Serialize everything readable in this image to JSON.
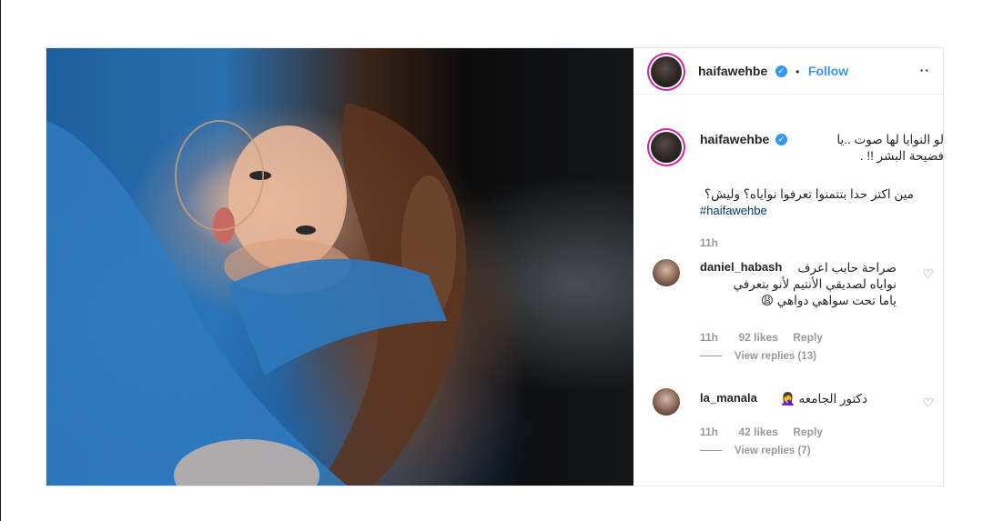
{
  "post": {
    "author": {
      "username": "haifawehbe",
      "follow_label": "Follow",
      "verified_glyph": "✓",
      "dot": "•"
    },
    "more_glyph": "··",
    "caption": {
      "line1": "لو النوايا لها صوت ..يا",
      "line2": "فضيحة البشر !! .",
      "line3": "مين اكتر حدا بتتمنوا تعرفوا نواياه؟ وليش؟",
      "hashtag": "#haifawehbe",
      "time": "11h"
    },
    "comments": [
      {
        "username": "daniel_habash",
        "text_line1": "صراحة حابب اعرف",
        "text_line2": "نواياه لصديقي الأنتيم لأنو بتعرفي",
        "text_line3": "ياما تحت سواهي دواهي 😩",
        "time": "11h",
        "likes": "92 likes",
        "reply_label": "Reply",
        "view_replies": "View replies (13)"
      },
      {
        "username": "la_manala",
        "text_line1": "دكتور الجامعه 🤦‍♀️",
        "time": "11h",
        "likes": "42 likes",
        "reply_label": "Reply",
        "view_replies": "View replies (7)"
      }
    ],
    "heart_glyph": "♡"
  },
  "icons": {
    "verified": "verified-badge-icon",
    "heart": "heart-icon",
    "more": "more-options-icon"
  },
  "colors": {
    "follow": "#3897f0",
    "verified": "#3897f0",
    "hashtag": "#003569",
    "muted": "#999999",
    "story_ring": "#d6249f"
  }
}
